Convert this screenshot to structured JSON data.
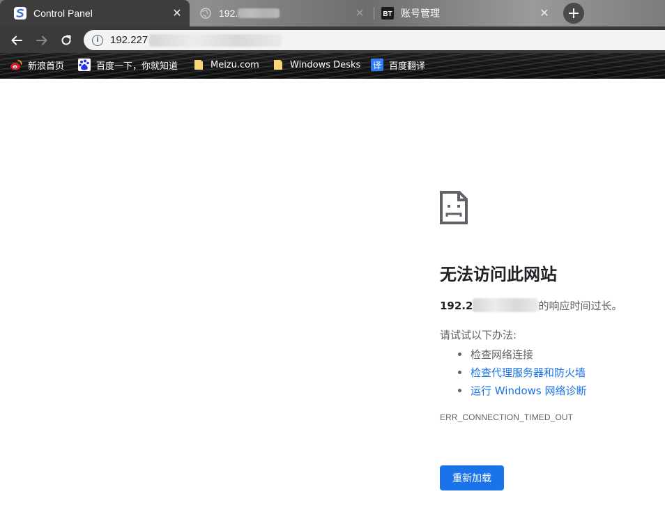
{
  "tabs": [
    {
      "title": "Control Panel",
      "icon": "control-panel-icon",
      "active": true
    },
    {
      "title": "192.",
      "icon": "globe-icon",
      "active": false
    },
    {
      "title": "账号管理",
      "icon": "bt-icon",
      "icon_text": "BT",
      "active": false
    }
  ],
  "toolbar": {
    "back_icon": "back-arrow-icon",
    "forward_icon": "forward-arrow-icon",
    "reload_icon": "reload-icon",
    "url": "192.227"
  },
  "bookmarks": [
    {
      "label": "新浪首页",
      "icon": "weibo-icon"
    },
    {
      "label": "百度一下，你就知道",
      "icon": "baidu-icon"
    },
    {
      "label": "Meizu.com",
      "icon": "folder-icon"
    },
    {
      "label": "Windows Desks",
      "icon": "folder-icon"
    },
    {
      "label": "百度翻译",
      "icon": "baidu-translate-icon",
      "icon_text": "译"
    }
  ],
  "error": {
    "title": "无法访问此网站",
    "host": "192.2",
    "summary_suffix": "的响应时间过长。",
    "try_label": "请试试以下办法:",
    "suggestions": [
      {
        "text": "检查网络连接",
        "link": false
      },
      {
        "text": "检查代理服务器和防火墙",
        "link": true
      },
      {
        "text": "运行 Windows 网络诊断",
        "link": true
      }
    ],
    "code": "ERR_CONNECTION_TIMED_OUT",
    "reload_label": "重新加载"
  },
  "colors": {
    "link": "#1a73e8",
    "button": "#1a73e8",
    "text": "#202124",
    "secondary_text": "#5f6368"
  }
}
